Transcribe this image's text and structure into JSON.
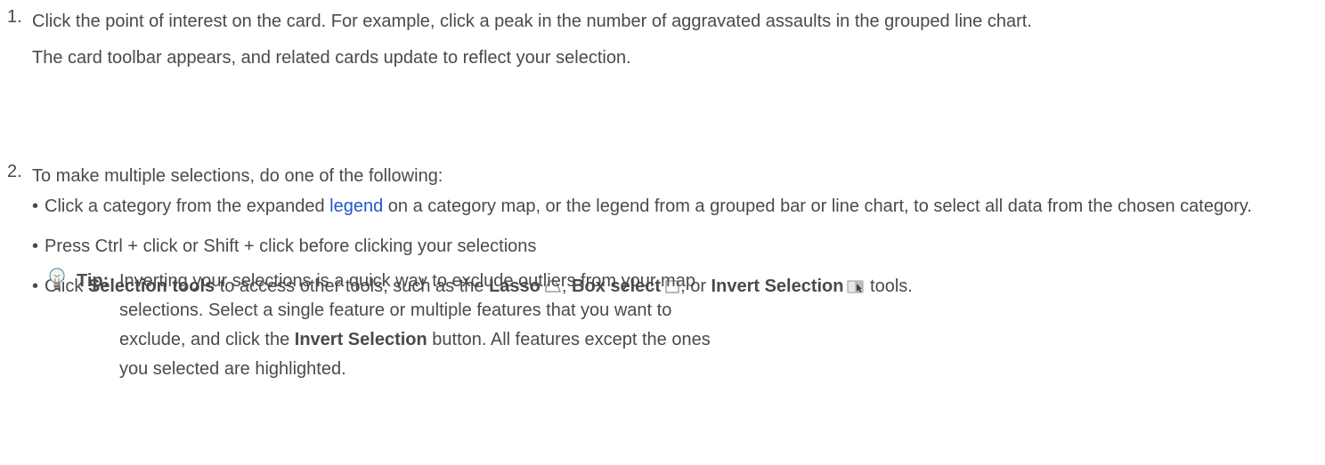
{
  "steps": [
    {
      "number": "1.",
      "text": "Click the point of interest on the card. For example, click a peak in the number of aggravated assaults in the grouped line chart.",
      "result": "The card toolbar appears, and related cards update to reflect your selection."
    },
    {
      "number": "2.",
      "text": "To make multiple selections, do one of the following:",
      "bullets": {
        "b1_before_link": "Click a category from the expanded ",
        "b1_link": "legend",
        "b1_after_link": " on a category map, or the legend from a grouped bar or line chart, to select all data from the chosen category.",
        "b2": "Press Ctrl + click or Shift + click before clicking your selections",
        "b3_part1": "Click ",
        "b3_selection_tools": "Selection tools",
        "b3_part2": " to access other tools, such as the ",
        "b3_lasso": "Lasso",
        "b3_sep1": ", ",
        "b3_box_select": "Box select",
        "b3_sep2": ", or ",
        "b3_invert": "Invert Selection",
        "b3_part3": " tools."
      },
      "tip": {
        "label": "Tip:",
        "part1": "Inverting your selections is a quick way to exclude outliers from your map selections. Select a single feature or multiple features that you want to exclude, and click the ",
        "button_name": "Invert Selection",
        "part2": " button. All features except the ones you selected are highlighted."
      }
    }
  ],
  "bullet_char": "•",
  "icons": {
    "lasso": "lasso-icon",
    "box_select": "box-select-icon",
    "invert_selection": "invert-selection-icon",
    "tip": "lightbulb-icon"
  },
  "colors": {
    "text": "#4a4a4a",
    "link": "#2355d1"
  }
}
